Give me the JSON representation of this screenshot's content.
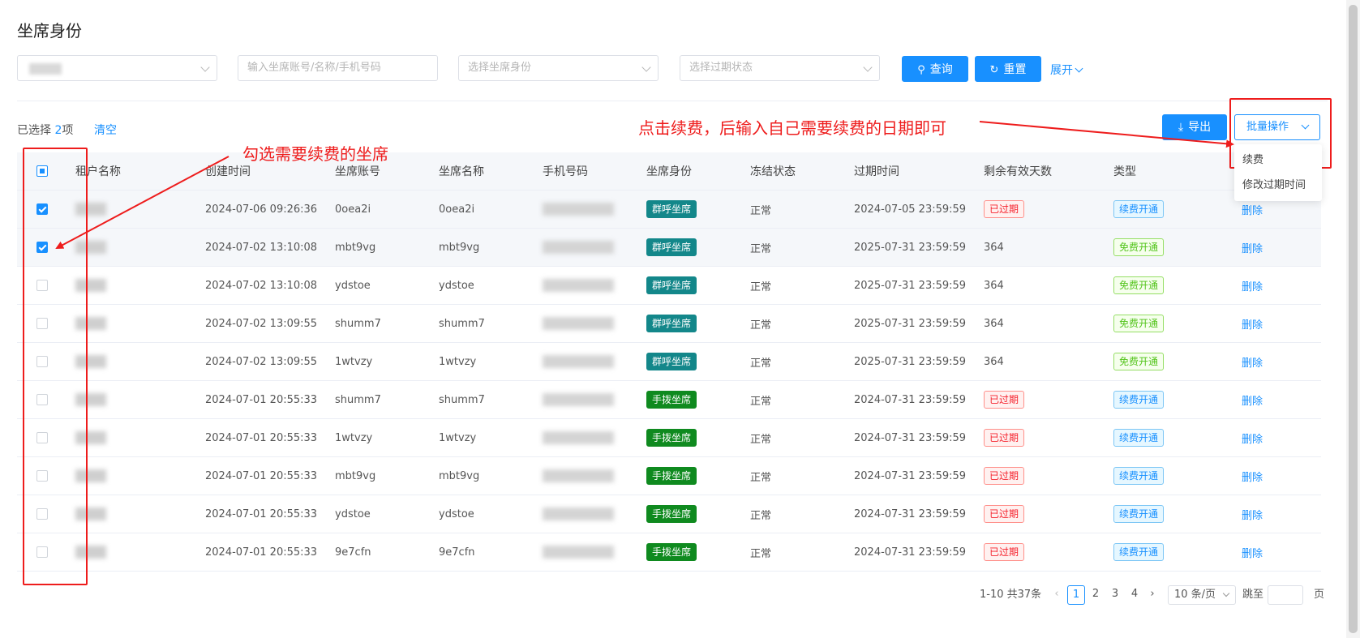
{
  "page_title": "坐席身份",
  "filters": {
    "tenant_value": "",
    "account_placeholder": "输入坐席账号/名称/手机号码",
    "identity_placeholder": "选择坐席身份",
    "expiry_placeholder": "选择过期状态",
    "query_label": "查询",
    "reset_label": "重置",
    "expand_label": "展开"
  },
  "selection": {
    "prefix": "已选择",
    "count": "2",
    "suffix": "项",
    "clear_label": "清空"
  },
  "toolbar": {
    "export_label": "导出",
    "batch_label": "批量操作",
    "batch_menu": [
      "续费",
      "修改过期时间"
    ]
  },
  "table": {
    "columns": [
      "租户名称",
      "创建时间",
      "坐席账号",
      "坐席名称",
      "手机号码",
      "坐席身份",
      "冻结状态",
      "过期时间",
      "剩余有效天数",
      "类型"
    ],
    "rows": [
      {
        "checked": true,
        "created": "2024-07-06 09:26:36",
        "account": "0oea2i",
        "name": "0oea2i",
        "identity": "群呼坐席",
        "identity_kind": "teal",
        "freeze": "正常",
        "expire": "2024-07-05 23:59:59",
        "remaining": "已过期",
        "remaining_expired": true,
        "type": "续费开通",
        "type_kind": "renew",
        "action": "删除"
      },
      {
        "checked": true,
        "created": "2024-07-02 13:10:08",
        "account": "mbt9vg",
        "name": "mbt9vg",
        "identity": "群呼坐席",
        "identity_kind": "teal",
        "freeze": "正常",
        "expire": "2025-07-31 23:59:59",
        "remaining": "364",
        "remaining_expired": false,
        "type": "免费开通",
        "type_kind": "free",
        "action": "删除"
      },
      {
        "checked": false,
        "created": "2024-07-02 13:10:08",
        "account": "ydstoe",
        "name": "ydstoe",
        "identity": "群呼坐席",
        "identity_kind": "teal",
        "freeze": "正常",
        "expire": "2025-07-31 23:59:59",
        "remaining": "364",
        "remaining_expired": false,
        "type": "免费开通",
        "type_kind": "free",
        "action": "删除"
      },
      {
        "checked": false,
        "created": "2024-07-02 13:09:55",
        "account": "shumm7",
        "name": "shumm7",
        "identity": "群呼坐席",
        "identity_kind": "teal",
        "freeze": "正常",
        "expire": "2025-07-31 23:59:59",
        "remaining": "364",
        "remaining_expired": false,
        "type": "免费开通",
        "type_kind": "free",
        "action": "删除"
      },
      {
        "checked": false,
        "created": "2024-07-02 13:09:55",
        "account": "1wtvzy",
        "name": "1wtvzy",
        "identity": "群呼坐席",
        "identity_kind": "teal",
        "freeze": "正常",
        "expire": "2025-07-31 23:59:59",
        "remaining": "364",
        "remaining_expired": false,
        "type": "免费开通",
        "type_kind": "free",
        "action": "删除"
      },
      {
        "checked": false,
        "created": "2024-07-01 20:55:33",
        "account": "shumm7",
        "name": "shumm7",
        "identity": "手拨坐席",
        "identity_kind": "green",
        "freeze": "正常",
        "expire": "2024-07-31 23:59:59",
        "remaining": "已过期",
        "remaining_expired": true,
        "type": "续费开通",
        "type_kind": "renew",
        "action": "删除"
      },
      {
        "checked": false,
        "created": "2024-07-01 20:55:33",
        "account": "1wtvzy",
        "name": "1wtvzy",
        "identity": "手拨坐席",
        "identity_kind": "green",
        "freeze": "正常",
        "expire": "2024-07-31 23:59:59",
        "remaining": "已过期",
        "remaining_expired": true,
        "type": "续费开通",
        "type_kind": "renew",
        "action": "删除"
      },
      {
        "checked": false,
        "created": "2024-07-01 20:55:33",
        "account": "mbt9vg",
        "name": "mbt9vg",
        "identity": "手拨坐席",
        "identity_kind": "green",
        "freeze": "正常",
        "expire": "2024-07-31 23:59:59",
        "remaining": "已过期",
        "remaining_expired": true,
        "type": "续费开通",
        "type_kind": "renew",
        "action": "删除"
      },
      {
        "checked": false,
        "created": "2024-07-01 20:55:33",
        "account": "ydstoe",
        "name": "ydstoe",
        "identity": "手拨坐席",
        "identity_kind": "green",
        "freeze": "正常",
        "expire": "2024-07-31 23:59:59",
        "remaining": "已过期",
        "remaining_expired": true,
        "type": "续费开通",
        "type_kind": "renew",
        "action": "删除"
      },
      {
        "checked": false,
        "created": "2024-07-01 20:55:33",
        "account": "9e7cfn",
        "name": "9e7cfn",
        "identity": "手拨坐席",
        "identity_kind": "green",
        "freeze": "正常",
        "expire": "2024-07-31 23:59:59",
        "remaining": "已过期",
        "remaining_expired": true,
        "type": "续费开通",
        "type_kind": "renew",
        "action": "删除"
      }
    ]
  },
  "pagination": {
    "summary": "1-10 共37条",
    "pages": [
      "1",
      "2",
      "3",
      "4"
    ],
    "current_page": "1",
    "page_size": "10 条/页",
    "goto_label": "跳至",
    "page_unit": "页"
  },
  "annotations": {
    "select_hint": "勾选需要续费的坐席",
    "renew_hint": "点击续费，后输入自己需要续费的日期即可"
  },
  "colors": {
    "primary": "#1890ff",
    "annotation": "#ee1c1c",
    "tag_group_call": "#13878a",
    "tag_manual_dial": "#0f8a1f"
  }
}
